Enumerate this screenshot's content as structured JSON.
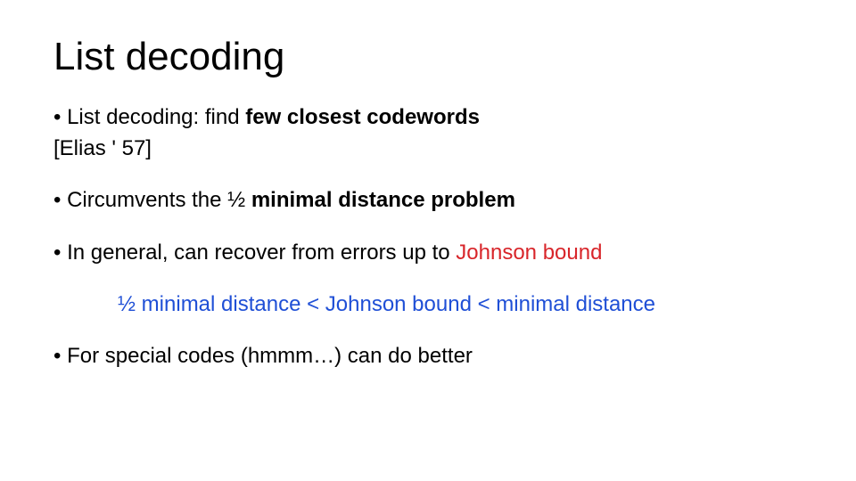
{
  "title": "List decoding",
  "bullets": {
    "b1": {
      "pre": "List decoding: find ",
      "em": "few closest codewords",
      "cite": "[Elias ' 57]"
    },
    "b2": {
      "pre": "Circumvents the ½ ",
      "em": "minimal distance problem"
    },
    "b3": {
      "pre": "In general, can recover from errors up to ",
      "jb": "Johnson bound"
    },
    "inequality": "½ minimal distance < Johnson bound < minimal distance",
    "b4": {
      "text": "For special codes (hmmm…) can do better"
    }
  }
}
